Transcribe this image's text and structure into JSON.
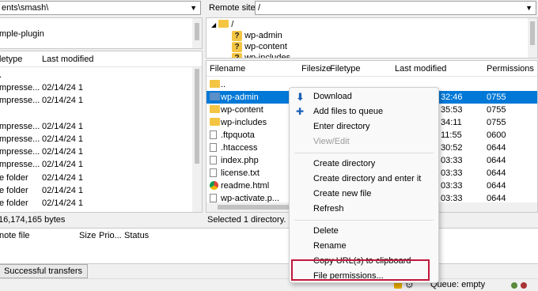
{
  "local_path": "ents\\smash\\",
  "remote_site_label": "Remote site:",
  "remote_path": "/",
  "local_tree": [
    {
      "label": "mple-plugin"
    }
  ],
  "remote_tree": [
    {
      "label": "/"
    },
    {
      "label": "wp-admin"
    },
    {
      "label": "wp-content"
    },
    {
      "label": "wp-includes"
    }
  ],
  "local_headers": {
    "filetype": "letype",
    "last_modified": "Last modified"
  },
  "local_rows": [
    {
      "type": ".",
      "date": ""
    },
    {
      "type": "mpresse...",
      "date": "02/14/24 1"
    },
    {
      "type": "mpresse...",
      "date": "02/14/24 1"
    },
    {
      "type": "",
      "date": ""
    },
    {
      "type": "mpresse...",
      "date": "02/14/24 1"
    },
    {
      "type": "mpresse...",
      "date": "02/14/24 1"
    },
    {
      "type": "mpresse...",
      "date": "02/14/24 1"
    },
    {
      "type": "mpresse...",
      "date": "02/14/24 1"
    },
    {
      "type": "e folder",
      "date": "02/14/24 1"
    },
    {
      "type": "e folder",
      "date": "02/14/24 1"
    },
    {
      "type": "e folder",
      "date": "02/14/24 1"
    },
    {
      "type": "e folder",
      "date": "02/14/24 1"
    }
  ],
  "local_status": "16,174,165 bytes",
  "remote_headers": {
    "filename": "Filename",
    "filesize": "Filesize",
    "filetype": "Filetype",
    "last_modified": "Last modified",
    "permissions": "Permissions"
  },
  "remote_rows": [
    {
      "name": "..",
      "icon": "folder",
      "time": "",
      "perm": ""
    },
    {
      "name": "wp-admin",
      "icon": "folder-blue",
      "time": "32:46",
      "perm": "0755"
    },
    {
      "name": "wp-content",
      "icon": "folder",
      "time": "35:53",
      "perm": "0755"
    },
    {
      "name": "wp-includes",
      "icon": "folder",
      "time": "34:11",
      "perm": "0755"
    },
    {
      "name": ".ftpquota",
      "icon": "file",
      "time": "11:55",
      "perm": "0600"
    },
    {
      "name": ".htaccess",
      "icon": "file",
      "time": "30:52",
      "perm": "0644"
    },
    {
      "name": "index.php",
      "icon": "file",
      "time": "03:33",
      "perm": "0644"
    },
    {
      "name": "license.txt",
      "icon": "file",
      "time": "03:33",
      "perm": "0644"
    },
    {
      "name": "readme.html",
      "icon": "chrome",
      "time": "03:33",
      "perm": "0644"
    },
    {
      "name": "wp-activate.p...",
      "icon": "file",
      "time": "03:33",
      "perm": "0644"
    }
  ],
  "remote_status": "Selected 1 directory.",
  "queue_headers": {
    "file": "note file",
    "size": "Size",
    "priority": "Prio...",
    "status": "Status"
  },
  "tabs": {
    "successful": "Successful transfers"
  },
  "status_bar": {
    "queue": "Queue: empty"
  },
  "context_menu": [
    {
      "label": "Download",
      "icon": "download-icon",
      "enabled": true
    },
    {
      "label": "Add files to queue",
      "icon": "add-queue-icon",
      "enabled": true
    },
    {
      "label": "Enter directory",
      "enabled": true
    },
    {
      "label": "View/Edit",
      "enabled": false
    },
    {
      "separator": true
    },
    {
      "label": "Create directory",
      "enabled": true
    },
    {
      "label": "Create directory and enter it",
      "enabled": true
    },
    {
      "label": "Create new file",
      "enabled": true
    },
    {
      "label": "Refresh",
      "enabled": true
    },
    {
      "separator": true
    },
    {
      "label": "Delete",
      "enabled": true
    },
    {
      "label": "Rename",
      "enabled": true
    },
    {
      "label": "Copy URL(s) to clipboard",
      "enabled": true
    },
    {
      "label": "File permissions...",
      "enabled": true,
      "highlighted": true
    }
  ],
  "colors": {
    "selection": "#0078d7",
    "highlight_box": "#c0183a"
  }
}
